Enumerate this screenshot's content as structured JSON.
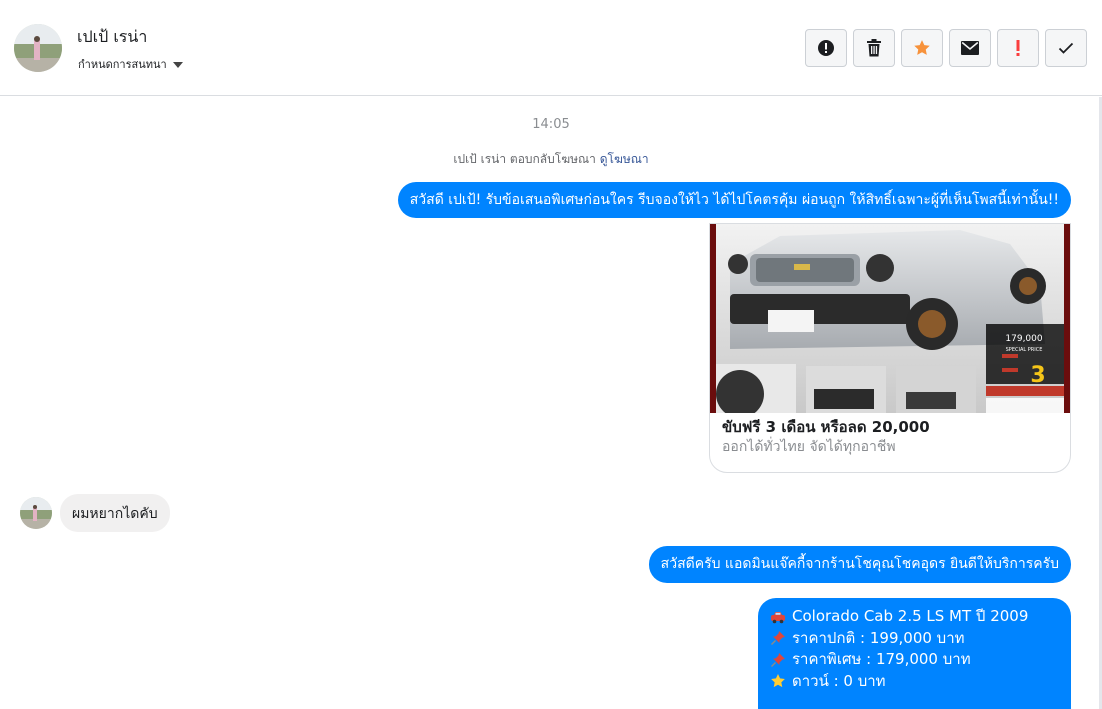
{
  "header": {
    "contact_name": "เปเป้ เรน่า",
    "chat_settings_label": "กำหนดการสนทนา",
    "toolbar": {
      "buttons": [
        {
          "icon": "alert-circle-icon"
        },
        {
          "icon": "trash-icon"
        },
        {
          "icon": "star-icon",
          "color": "#f7923b"
        },
        {
          "icon": "envelope-icon"
        },
        {
          "icon": "exclamation-icon",
          "color": "#fa3e3e"
        },
        {
          "icon": "check-icon"
        }
      ]
    }
  },
  "thread": {
    "timestamp": "14:05",
    "reply_note": {
      "text": "เปเป้ เรน่า ตอบกลับโฆษณา",
      "link": "ดูโฆษณา"
    },
    "messages": [
      {
        "from": "page",
        "text": "สวัสดี เปเป้! รับข้อเสนอพิเศษก่อนใคร รีบจองให้ไว ได้ไปโคตรคุ้ม ผ่อนถูก ให้สิทธิ์เฉพาะผู้ที่เห็นโพสนี้เท่านั้น!!"
      },
      {
        "from": "page",
        "type": "ad_card",
        "image_text": {
          "price": "179,000",
          "special": "SPECIAL PRICE",
          "promo_number": "3"
        },
        "title": "ขับฟรี 3 เดือน หรือลด 20,000",
        "subtitle": "ออกได้ทั่วไทย จัดได้ทุกอาชีพ"
      },
      {
        "from": "user",
        "text": "ผมหยากไดคับ"
      },
      {
        "from": "page",
        "text": "สวัสดีครับ แอดมินแจ๊คกี้จากร้านโชคุณโชคอุดร ยินดีให้บริการครับ"
      },
      {
        "from": "page",
        "type": "details",
        "lines": [
          {
            "icon": "car-icon",
            "text": "Colorado Cab 2.5 LS MT ปี 2009"
          },
          {
            "icon": "pushpin-icon",
            "text": "ราคาปกติ : 199,000 บาท"
          },
          {
            "icon": "pushpin-icon",
            "text": "ราคาพิเศษ : 179,000 บาท"
          },
          {
            "icon": "star-icon",
            "text": "ดาวน์ : 0 บาท"
          }
        ]
      }
    ]
  },
  "colors": {
    "accent": "#0084ff",
    "incoming_bubble": "#f1f0f0",
    "link": "#385898",
    "muted": "#8a8d91"
  }
}
